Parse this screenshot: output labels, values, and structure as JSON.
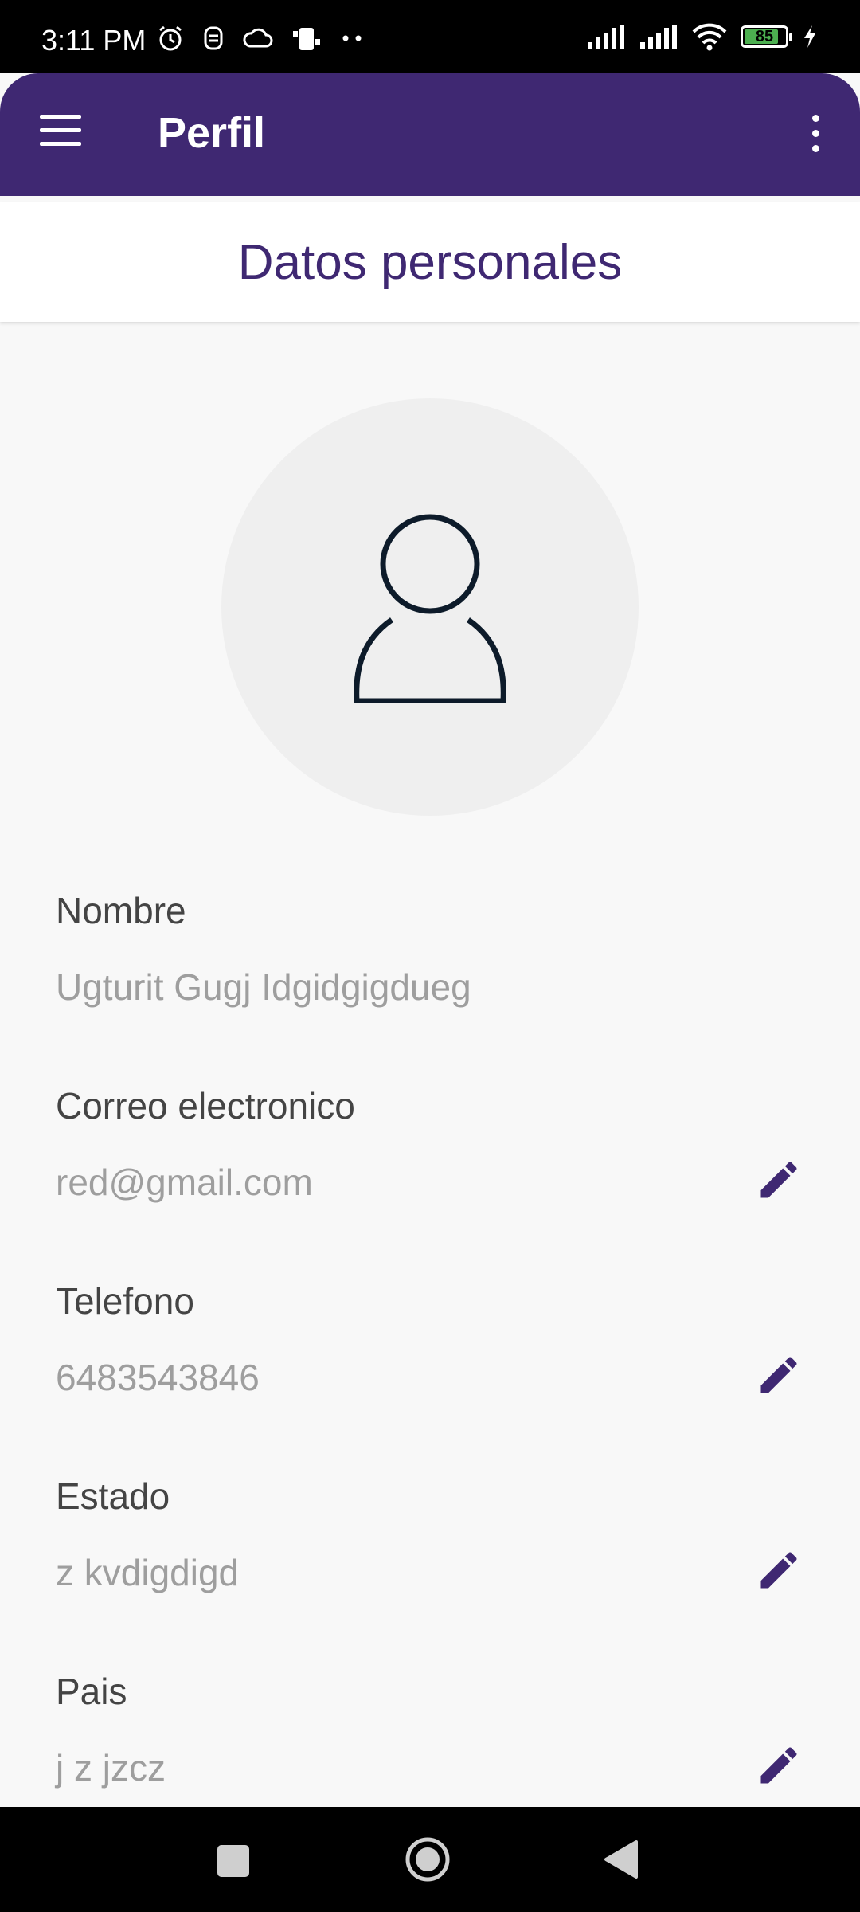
{
  "status_bar": {
    "time": "3:11 PM",
    "battery_level": "85",
    "battery_fraction": 0.85,
    "icons_left": [
      "alarm-icon",
      "notification-icon",
      "cloud-icon",
      "phone-icon",
      "more-dots-icon"
    ],
    "icons_right": [
      "signal-icon",
      "signal-icon",
      "wifi-icon",
      "battery-icon",
      "charging-icon"
    ]
  },
  "app_bar": {
    "title": "Perfil",
    "menu_icon": "hamburger-menu-icon",
    "overflow_icon": "more-vert-icon",
    "color": "#3f2872"
  },
  "section": {
    "title": "Datos personales"
  },
  "avatar": {
    "icon": "person-icon"
  },
  "fields": [
    {
      "label": "Nombre",
      "value": "Ugturit Gugj Idgidgigdueg",
      "editable": false
    },
    {
      "label": "Correo electronico",
      "value": "red@gmail.com",
      "editable": true
    },
    {
      "label": "Telefono",
      "value": "6483543846",
      "editable": true
    },
    {
      "label": "Estado",
      "value": "z kvdigdigd",
      "editable": true
    },
    {
      "label": "Pais",
      "value": "j z jzcz",
      "editable": true
    }
  ],
  "nav_bar": {
    "buttons": [
      "recents-icon",
      "home-icon",
      "back-icon"
    ]
  },
  "colors": {
    "accent": "#3f2872",
    "label": "#444444",
    "value": "#9e9e9e",
    "background": "#f8f8f8"
  }
}
